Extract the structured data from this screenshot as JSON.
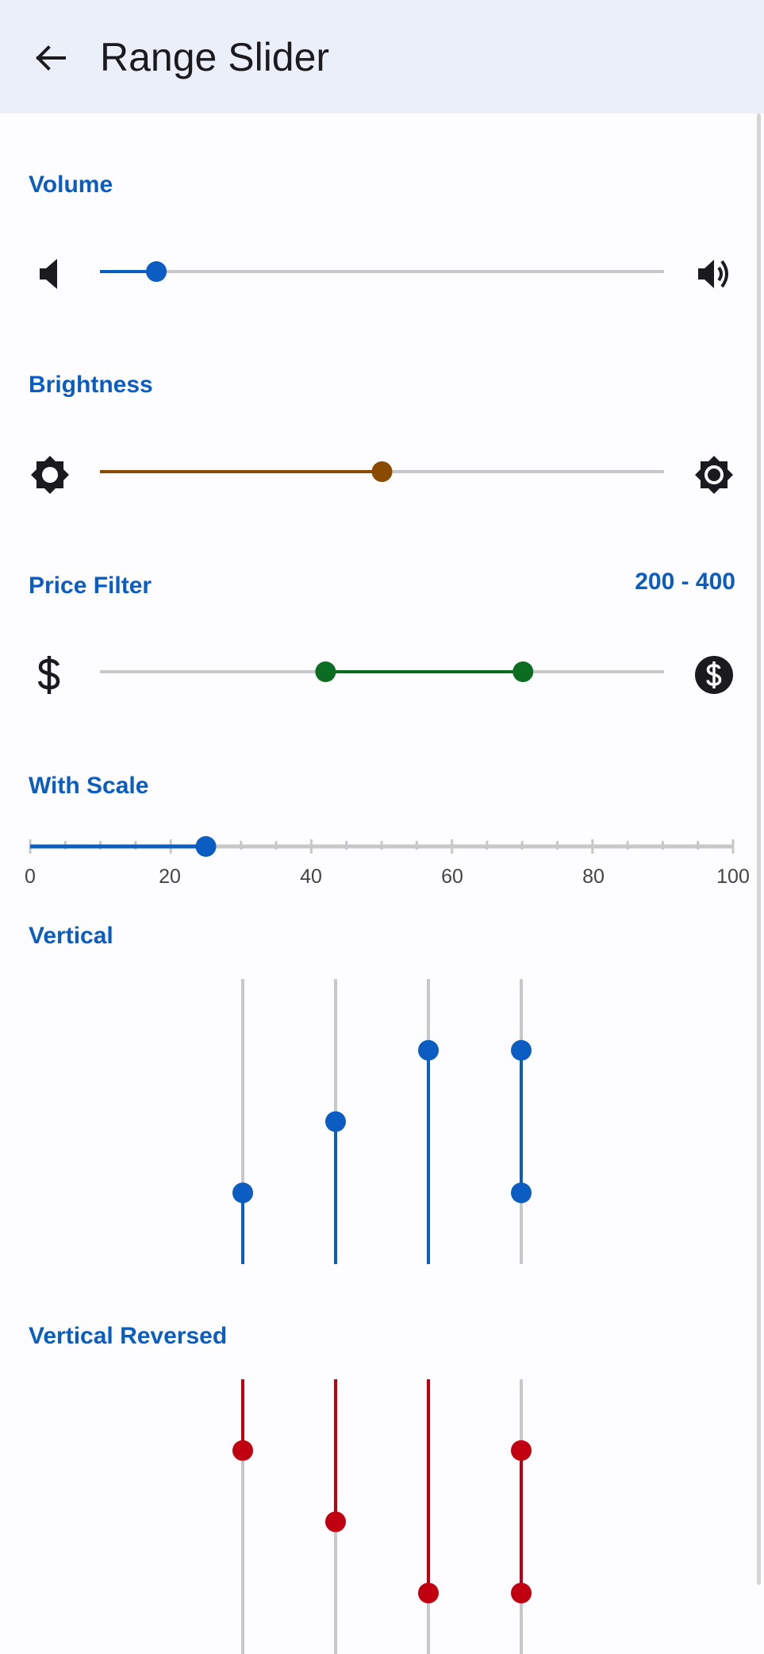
{
  "app_bar": {
    "title": "Range Slider",
    "back_icon": "arrow-back-icon"
  },
  "colors": {
    "primary": "#0b5dc1",
    "brightness": "#8a4a00",
    "price": "#0a6d22",
    "reversed": "#c00010",
    "inactive_track": "#c8c8c8",
    "appbar_bg": "#eaeff9"
  },
  "volume": {
    "label": "Volume",
    "min_icon": "volume-mute-icon",
    "max_icon": "volume-up-icon",
    "value": 0.1
  },
  "brightness": {
    "label": "Brightness",
    "min_icon": "brightness-low-icon",
    "max_icon": "brightness-high-icon",
    "value": 0.5
  },
  "price_filter": {
    "label": "Price Filter",
    "range_text": "200 - 400",
    "min_icon": "dollar-icon",
    "max_icon": "dollar-circle-icon",
    "start": 0.4,
    "end": 0.75
  },
  "with_scale": {
    "label": "With Scale",
    "value": 25,
    "min": 0,
    "max": 100,
    "tick_labels": [
      "0",
      "20",
      "40",
      "60",
      "80",
      "100"
    ]
  },
  "vertical": {
    "label": "Vertical",
    "sliders": [
      {
        "start": 0.0,
        "end": 0.25
      },
      {
        "start": 0.0,
        "end": 0.5
      },
      {
        "start": 0.0,
        "end": 0.75
      },
      {
        "start": 0.25,
        "end": 0.75
      }
    ]
  },
  "vertical_reversed": {
    "label": "Vertical Reversed",
    "sliders": [
      {
        "start": 0.0,
        "end": 0.25
      },
      {
        "start": 0.0,
        "end": 0.5
      },
      {
        "start": 0.0,
        "end": 0.75
      },
      {
        "start": 0.25,
        "end": 0.75
      }
    ]
  }
}
